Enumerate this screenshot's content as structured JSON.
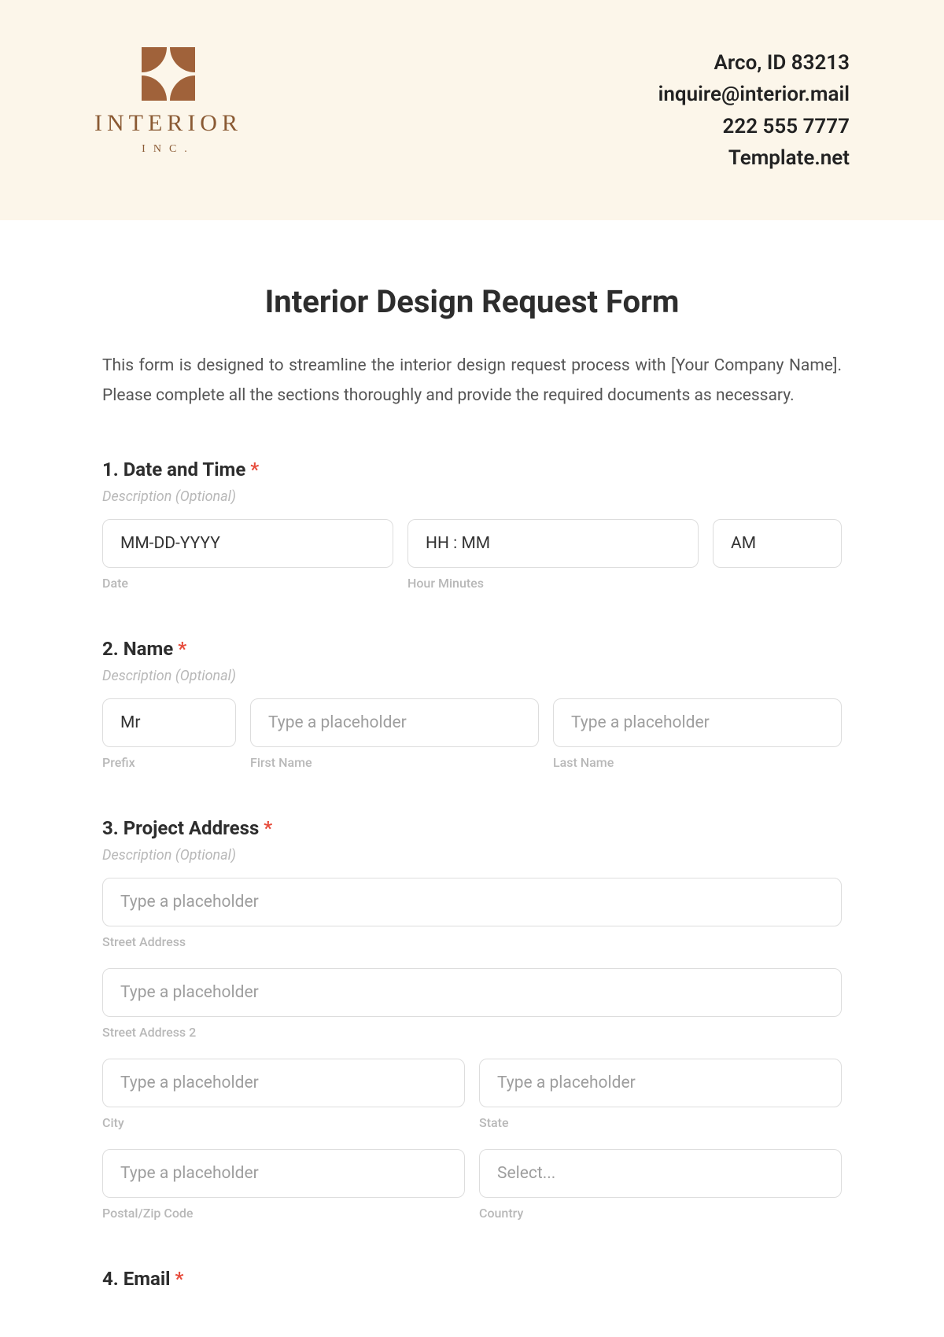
{
  "header": {
    "logo": {
      "word": "INTERIOR",
      "sub": "INC."
    },
    "contact": {
      "address": "Arco, ID 83213",
      "email": "inquire@interior.mail",
      "phone": "222 555 7777",
      "site": "Template.net"
    }
  },
  "form": {
    "title": "Interior Design Request Form",
    "intro": "This form is designed to streamline the interior design request process with [Your Company Name]. Please complete all the sections thoroughly and provide the required documents as necessary.",
    "desc_optional": "Description (Optional)",
    "required_mark": "*",
    "q1": {
      "label": "1. Date and Time",
      "date": {
        "placeholder": "MM-DD-YYYY",
        "sublabel": "Date"
      },
      "time": {
        "placeholder": "HH : MM",
        "sublabel": "Hour Minutes"
      },
      "ampm": {
        "value": "AM"
      }
    },
    "q2": {
      "label": "2. Name",
      "prefix": {
        "value": "Mr",
        "sublabel": "Prefix"
      },
      "first": {
        "placeholder": "Type a placeholder",
        "sublabel": "First Name"
      },
      "last": {
        "placeholder": "Type a placeholder",
        "sublabel": "Last Name"
      }
    },
    "q3": {
      "label": "3. Project Address",
      "street1": {
        "placeholder": "Type a placeholder",
        "sublabel": "Street Address"
      },
      "street2": {
        "placeholder": "Type a placeholder",
        "sublabel": "Street Address 2"
      },
      "city": {
        "placeholder": "Type a placeholder",
        "sublabel": "City"
      },
      "state": {
        "placeholder": "Type a placeholder",
        "sublabel": "State"
      },
      "zip": {
        "placeholder": "Type a placeholder",
        "sublabel": "Postal/Zip Code"
      },
      "country": {
        "placeholder": "Select...",
        "sublabel": "Country"
      }
    },
    "q4": {
      "label": "4. Email"
    }
  }
}
